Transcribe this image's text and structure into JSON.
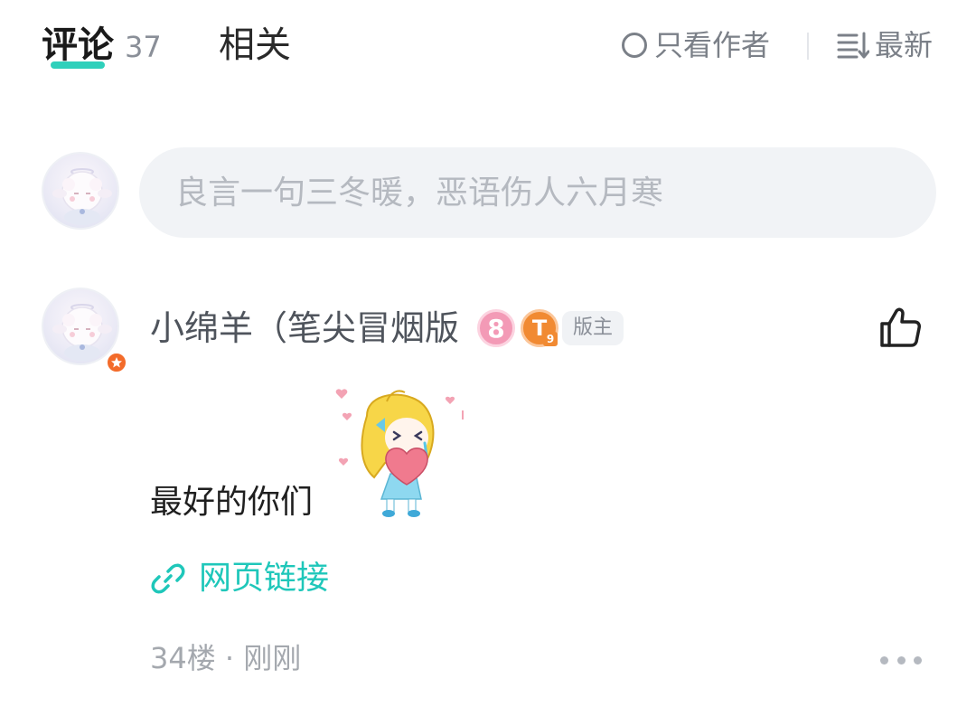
{
  "tabs": {
    "comments_label": "评论",
    "comments_count": "37",
    "related_label": "相关"
  },
  "filters": {
    "author_only_label": "只看作者",
    "sort_label": "最新"
  },
  "input": {
    "placeholder": "良言一句三冬暖，恶语伤人六月寒"
  },
  "comment": {
    "username": "小绵羊（笔尖冒烟版",
    "level": "8",
    "tier": "T",
    "tier_sub": "9",
    "role": "版主",
    "text": "最好的你们",
    "link_label": "网页链接",
    "meta": "34楼 · 刚刚"
  },
  "colors": {
    "accent": "#2fd0bb",
    "link": "#1fc7ba",
    "level_badge": "#f39ab6",
    "tier_badge": "#f18a32",
    "moderator_dot": "#f36b2a"
  }
}
